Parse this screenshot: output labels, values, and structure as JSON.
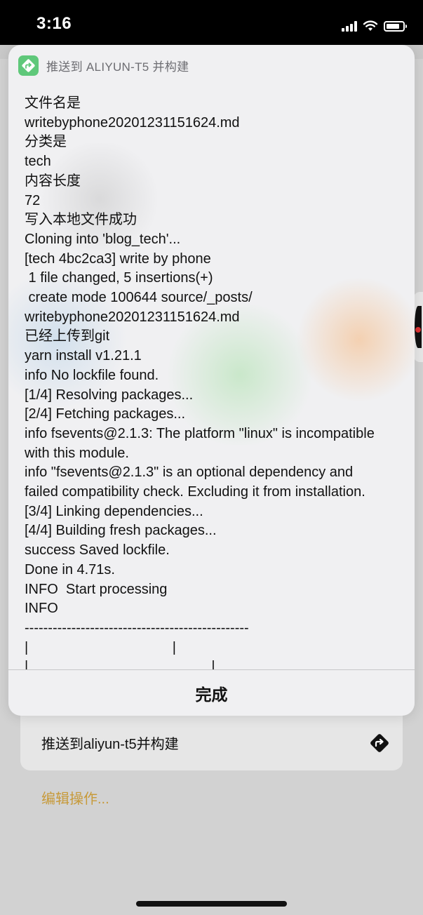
{
  "status_bar": {
    "time": "3:16"
  },
  "panel": {
    "title": "推送到 ALIYUN-T5 并构建",
    "app_icon": "shortcut-arrow-icon",
    "app_icon_color": "#5fc87a",
    "log_lines": [
      "文件名是",
      "writebyphone20201231151624.md",
      "分类是",
      "tech",
      "内容长度",
      "72",
      "写入本地文件成功",
      "Cloning into 'blog_tech'...",
      "[tech 4bc2ca3] write by phone",
      " 1 file changed, 5 insertions(+)",
      " create mode 100644 source/_posts/",
      "writebyphone20201231151624.md",
      "已经上传到git",
      "yarn install v1.21.1",
      "info No lockfile found.",
      "[1/4] Resolving packages...",
      "[2/4] Fetching packages...",
      "info fsevents@2.1.3: The platform \"linux\" is incompatible",
      "with this module.",
      "info \"fsevents@2.1.3\" is an optional dependency and",
      "failed compatibility check. Excluding it from installation.",
      "[3/4] Linking dependencies...",
      "[4/4] Building fresh packages...",
      "success Saved lockfile.",
      "Done in 4.71s.",
      "INFO  Start processing",
      "INFO",
      "------------------------------------------------",
      "|                                     |",
      "|                                               |"
    ],
    "done_label": "完成"
  },
  "background": {
    "action_label": "推送到aliyun-t5并构建",
    "action_icon": "directions-arrow-icon",
    "edit_link": "编辑操作...",
    "edit_link_color": "#c79a3a"
  }
}
